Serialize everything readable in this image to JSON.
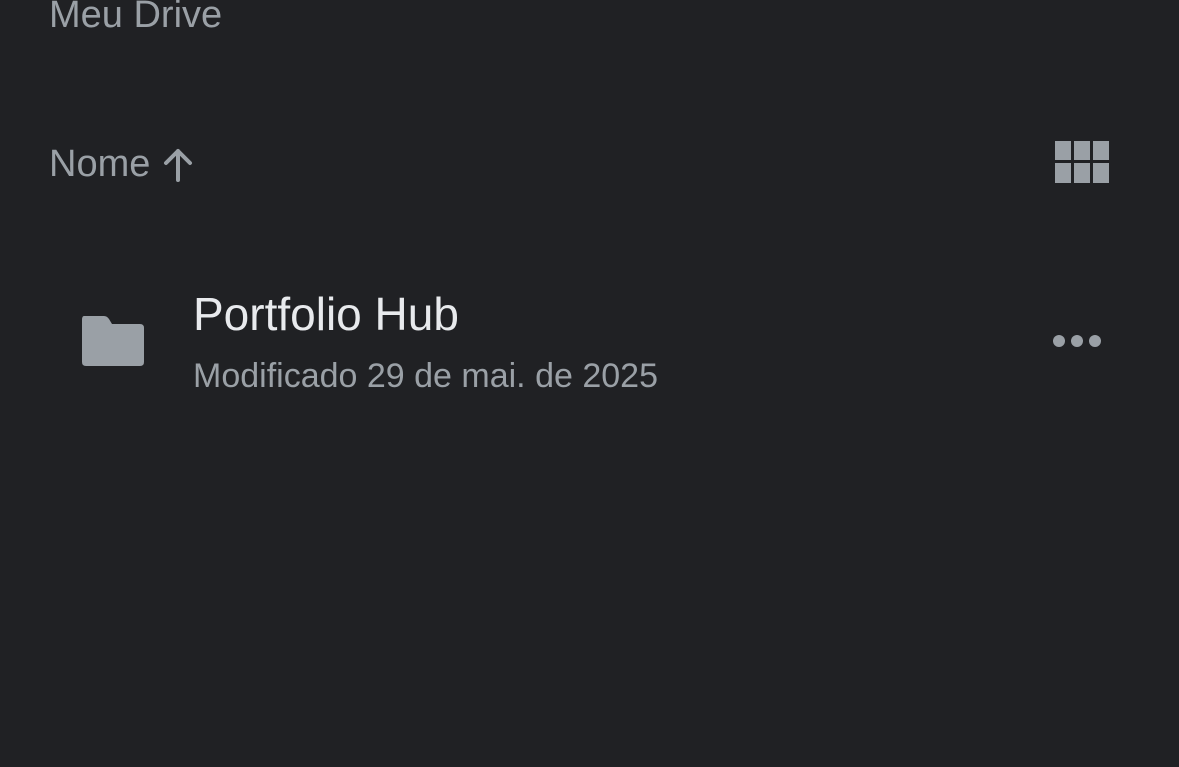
{
  "header": {
    "title": "Meu Drive"
  },
  "toolbar": {
    "sort_label": "Nome",
    "sort_direction_icon": "arrow-up-icon",
    "view_toggle_icon": "grid-view-icon"
  },
  "files": [
    {
      "icon": "folder-icon",
      "name": "Portfolio Hub",
      "modified": "Modificado 29 de mai. de 2025",
      "more_icon": "more-horizontal-icon"
    }
  ],
  "colors": {
    "background": "#202124",
    "primary_text": "#e8eaed",
    "secondary_text": "#9aa0a6",
    "icon": "#9aa0a6"
  }
}
